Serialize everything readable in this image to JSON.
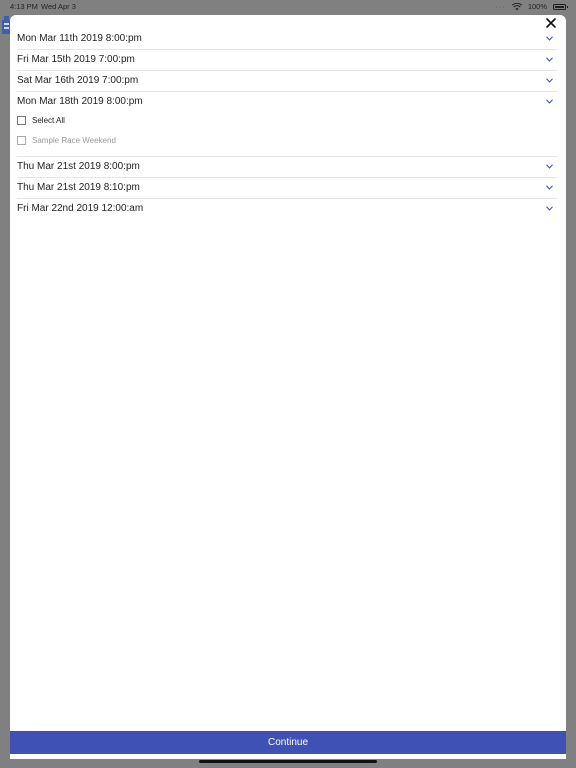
{
  "status_bar": {
    "time": "4:13 PM",
    "date": "Wed Apr 3",
    "signal": "···",
    "battery": "100%",
    "icons": [
      "wifi-icon",
      "battery-icon"
    ]
  },
  "modal": {
    "close_icon": "close-icon",
    "dates": [
      {
        "label": "Mon Mar 11th 2019 8:00:pm"
      },
      {
        "label": "Fri Mar 15th 2019 7:00:pm"
      },
      {
        "label": "Sat Mar 16th 2019 7:00:pm"
      },
      {
        "label": "Mon Mar 18th 2019 8:00:pm",
        "expanded": true
      },
      {
        "label": "Thu Mar 21st 2019 8:00:pm"
      },
      {
        "label": "Thu Mar 21st 2019 8:10:pm"
      },
      {
        "label": "Fri Mar 22nd 2019 12:00:am"
      }
    ],
    "expanded_options": {
      "select_all": "Select All",
      "sample_event": "Sample Race Weekend"
    },
    "continue_label": "Continue"
  },
  "colors": {
    "accent": "#3f51b5",
    "overlay": "#808080",
    "chevron": "#3f51b5"
  }
}
